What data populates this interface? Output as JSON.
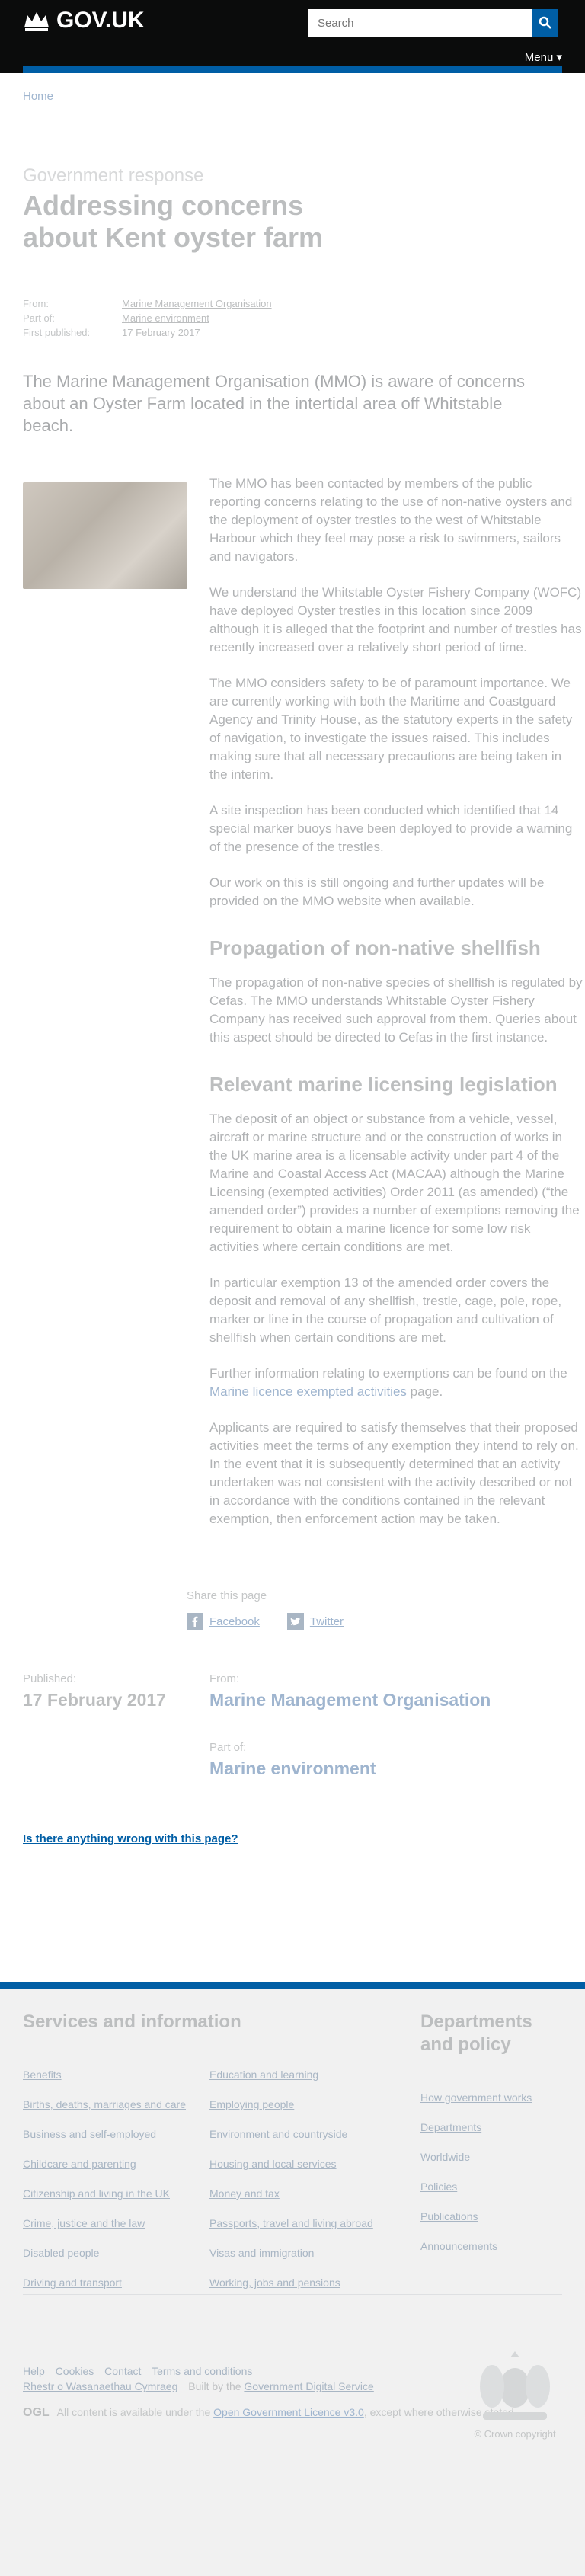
{
  "header": {
    "logo_text": "GOV.UK",
    "search_placeholder": "Search",
    "menu_label": "Menu"
  },
  "breadcrumb": {
    "home": "Home"
  },
  "page": {
    "kicker": "Government response",
    "title": "Addressing concerns about Kent oyster farm"
  },
  "meta": {
    "from_label": "From:",
    "from_value": "Marine Management Organisation",
    "part_label": "Part of:",
    "part_value": "Marine environment",
    "published_label": "First published:",
    "published_value": "17 February 2017"
  },
  "lead": "The Marine Management Organisation (MMO) is aware of concerns about an Oyster Farm located in the intertidal area off Whitstable beach.",
  "body": {
    "p1": "The MMO has been contacted by members of the public reporting concerns relating to the use of non-native oysters and the deployment of oyster trestles to the west of Whitstable Harbour which they feel may pose a risk to swimmers, sailors and navigators.",
    "p2": "We understand the Whitstable Oyster Fishery Company (WOFC) have deployed Oyster trestles in this location since 2009 although it is alleged that the footprint and number of trestles has recently increased over a relatively short period of time.",
    "p3": "The MMO considers safety to be of paramount importance. We are currently working with both the Maritime and Coastguard Agency and Trinity House, as the statutory experts in the safety of navigation, to investigate the issues raised. This includes making sure that all necessary precautions are being taken in the interim.",
    "p4": "A site inspection has been conducted which identified that 14 special marker buoys have been deployed to provide a warning of the presence of the trestles.",
    "p5": "Our work on this is still ongoing and further updates will be provided on the MMO website when available.",
    "h_propagation": "Propagation of non-native shellfish",
    "p6": "The propagation of non-native species of shellfish is regulated by Cefas. The MMO understands Whitstable Oyster Fishery Company has received such approval from them. Queries about this aspect should be directed to Cefas in the first instance.",
    "h_licensing": "Relevant marine licensing legislation",
    "p7": "The deposit of an object or substance from a vehicle, vessel, aircraft or marine structure and or the construction of works in the UK marine area is a licensable activity under part 4 of the Marine and Coastal Access Act (MACAA) although the Marine Licensing (exempted activities) Order 2011 (as amended) (“the amended order”) provides a number of exemptions removing the requirement to obtain a marine licence for some low risk activities where certain conditions are met.",
    "p8": "In particular exemption 13 of the amended order covers the deposit and removal of any shellfish, trestle, cage, pole, rope, marker or line in the course of propagation and cultivation of shellfish when certain conditions are met.",
    "p9_before": "Further information relating to exemptions can be found on the ",
    "p9_link": "Marine licence exempted activities",
    "p9_after": " page.",
    "p10": "Applicants are required to satisfy themselves that their proposed activities meet the terms of any exemption they intend to rely on. In the event that it is subsequently determined that an activity undertaken was not consistent with the activity described or not in accordance with the conditions contained in the relevant exemption, then enforcement action may be taken."
  },
  "share": {
    "label": "Share this page",
    "facebook": "Facebook",
    "twitter": "Twitter"
  },
  "published": {
    "label": "Published:",
    "date": "17 February 2017",
    "from_label": "From:",
    "from_value": "Marine Management Organisation",
    "part_label": "Part of:",
    "part_value": "Marine environment"
  },
  "report_link": "Is there anything wrong with this page?",
  "footer": {
    "services_title": "Services and information",
    "services": [
      "Benefits",
      "Education and learning",
      "Births, deaths, marriages and care",
      "Employing people",
      "Business and self-employed",
      "Environment and countryside",
      "Childcare and parenting",
      "Housing and local services",
      "Citizenship and living in the UK",
      "Money and tax",
      "Crime, justice and the law",
      "Passports, travel and living abroad",
      "Disabled people",
      "Visas and immigration",
      "Driving and transport",
      "Working, jobs and pensions"
    ],
    "depts_title": "Departments and policy",
    "depts": [
      "How government works",
      "Departments",
      "Worldwide",
      "Policies",
      "Publications",
      "Announcements"
    ],
    "bottom_links": [
      "Help",
      "Cookies",
      "Contact",
      "Terms and conditions"
    ],
    "welsh": "Rhestr o Wasanaethau Cymraeg",
    "built_prefix": "Built by the ",
    "built_link": "Government Digital Service",
    "ogl_label": "OGL",
    "licence_before": "All content is available under the ",
    "licence_link": "Open Government Licence v3.0",
    "licence_after": ", except where otherwise stated",
    "copyright": "© Crown copyright"
  },
  "colors": {
    "brand_blue": "#005ea5",
    "header_black": "#0b0c0c",
    "footer_grey": "#f1f1f1"
  }
}
